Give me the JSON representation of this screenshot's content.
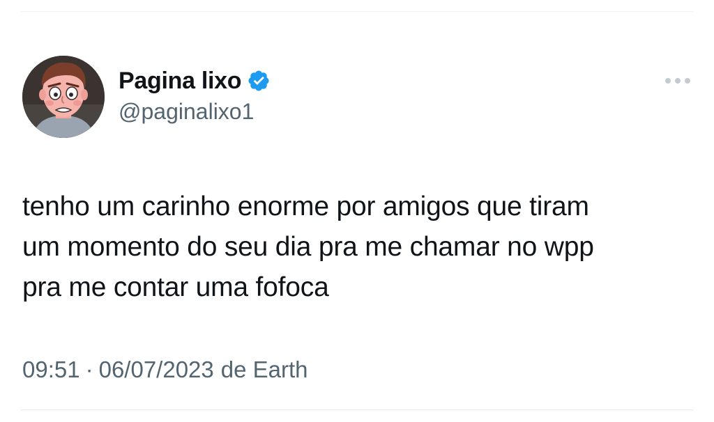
{
  "tweet": {
    "author": {
      "display_name": "Pagina lixo",
      "handle": "@paginalixo1",
      "verified": true
    },
    "text": "tenho um carinho enorme por amigos que tiram\num momento do seu dia pra me chamar no wpp\npra me contar uma fofoca",
    "time": "09:51",
    "separator": "·",
    "date": "06/07/2023",
    "source": "de Earth"
  },
  "icons": {
    "verified": "verified-badge-icon",
    "more": "more-horizontal-icon"
  },
  "colors": {
    "verified": "#1d9bf0",
    "text": "#0f1419",
    "secondary": "#536471",
    "divider": "#eff3f4"
  }
}
